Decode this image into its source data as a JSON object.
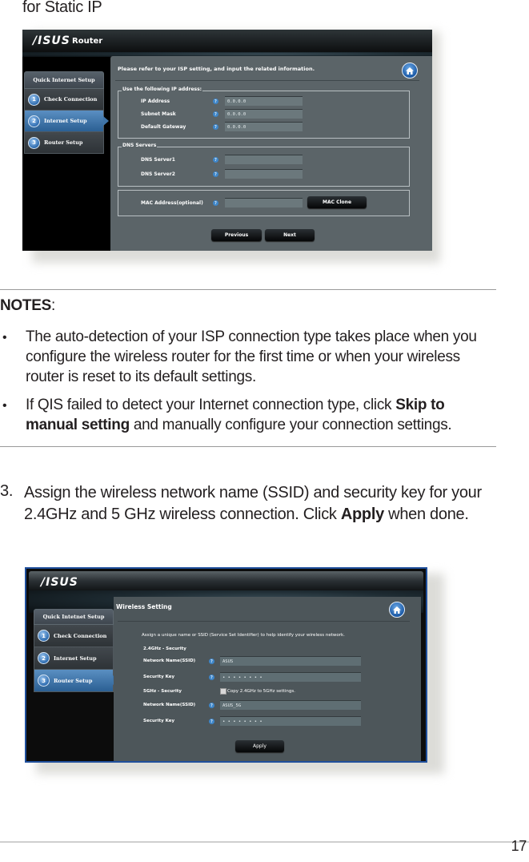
{
  "caption": "for Static IP",
  "screenshot1": {
    "brand": "/ISUS",
    "app_name": "Router",
    "sidebar": {
      "title": "Quick Internet Setup",
      "items": [
        {
          "num": "1",
          "label": "Check Connection",
          "active": false
        },
        {
          "num": "2",
          "label": "Internet Setup",
          "active": true
        },
        {
          "num": "3",
          "label": "Router Setup",
          "active": false
        }
      ]
    },
    "instruction": "Please refer to your ISP setting, and input the related information.",
    "ip_section": {
      "legend": "Use the following IP address:",
      "fields": [
        {
          "label": "IP Address",
          "value": "0.0.0.0"
        },
        {
          "label": "Subnet Mask",
          "value": "0.0.0.0"
        },
        {
          "label": "Default Gateway",
          "value": "0.0.0.0"
        }
      ]
    },
    "dns_section": {
      "legend": "DNS Servers",
      "fields": [
        {
          "label": "DNS Server1",
          "value": ""
        },
        {
          "label": "DNS Server2",
          "value": ""
        }
      ]
    },
    "mac_section": {
      "label": "MAC Address(optional)",
      "value": "",
      "button": "MAC Clone"
    },
    "buttons": {
      "previous": "Previous",
      "next": "Next"
    },
    "help_glyph": "?"
  },
  "notes": {
    "title": "NOTES",
    "title_suffix": ":",
    "bullet_glyph": "•",
    "items": [
      {
        "text": "The auto-detection of your ISP connection type takes place when you configure the wireless router for the first time or when your wireless router is reset to its default settings."
      },
      {
        "pre": "If QIS failed to detect your Internet connection type, click ",
        "bold": "Skip to manual setting",
        "post": " and manually configure your connection settings."
      }
    ]
  },
  "step3": {
    "number": "3.",
    "pre": "Assign the wireless network name (SSID) and security key for your 2.4GHz and 5 GHz wireless connection. Click ",
    "bold": "Apply",
    "post": " when done."
  },
  "screenshot2": {
    "brand": "/ISUS",
    "sidebar": {
      "title": "Quick Intetnet Setup",
      "items": [
        {
          "num": "1",
          "label": "Check Connection",
          "active": false
        },
        {
          "num": "2",
          "label": "Internet Setup",
          "active": false
        },
        {
          "num": "3",
          "label": "Router Setup",
          "active": true
        }
      ]
    },
    "title": "Wireless Setting",
    "instruction": "Assign a unique name or SSID (Service Set Identifier) to help identify your wireless network.",
    "band24_label": "2.4GHz - Security",
    "band5_label": "5GHz - Security",
    "copy_checkbox_label": "Copy 2.4GHz to 5GHz settings.",
    "copy_checked": false,
    "fields": [
      {
        "label": "Network Name(SSID)",
        "value": "ASUS"
      },
      {
        "label": "Security Key",
        "value": "• • • • • • • •"
      },
      {
        "label": "Network Name(SSID)",
        "value": "ASUS_5G"
      },
      {
        "label": "Security Key",
        "value": "• • • • • • • •"
      }
    ],
    "apply_button": "Apply",
    "help_glyph": "?"
  },
  "page_number": "17",
  "colors": {
    "accent_blue": "#2b5f93",
    "panel_gray": "#5b6468",
    "frame_blue": "#1f4f9c"
  }
}
